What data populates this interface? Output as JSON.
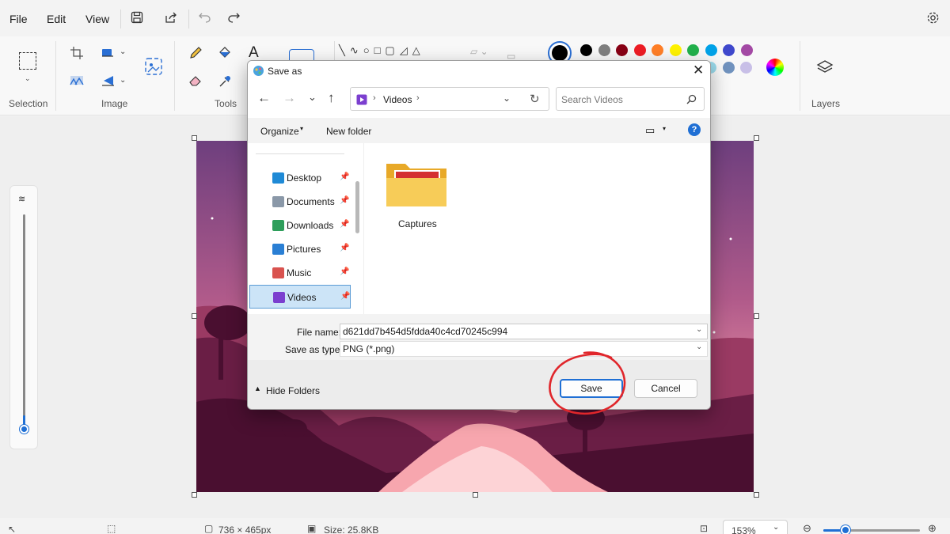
{
  "menu": {
    "file": "File",
    "edit": "Edit",
    "view": "View"
  },
  "ribbon": {
    "groups": {
      "selection": "Selection",
      "image": "Image",
      "tools": "Tools",
      "layers": "Layers"
    },
    "palette_row1": [
      "#000000",
      "#7f7f7f",
      "#880015",
      "#ed1c24",
      "#ff7f27",
      "#fff200",
      "#22b14c",
      "#00a2e8",
      "#3f48cc",
      "#a349a4"
    ],
    "palette_row2": [
      "#99d9ea",
      "#7092be",
      "#c8bfe7"
    ],
    "text_tool_glyph": "A"
  },
  "statusbar": {
    "dimensions": "736 × 465px",
    "size": "Size: 25.8KB",
    "zoom": "153%"
  },
  "dialog": {
    "title": "Save as",
    "breadcrumb": "Videos",
    "search_placeholder": "Search Videos",
    "organize": "Organize",
    "new_folder": "New folder",
    "nav_items": [
      {
        "label": "Desktop",
        "icon": "desktop-icon",
        "color": "#1f8ad6"
      },
      {
        "label": "Documents",
        "icon": "documents-icon",
        "color": "#8a98a8"
      },
      {
        "label": "Downloads",
        "icon": "downloads-icon",
        "color": "#2e9e5b"
      },
      {
        "label": "Pictures",
        "icon": "pictures-icon",
        "color": "#2a7fd4"
      },
      {
        "label": "Music",
        "icon": "music-icon",
        "color": "#d9534f"
      },
      {
        "label": "Videos",
        "icon": "videos-icon",
        "color": "#7b3fcf"
      }
    ],
    "folder_name": "Captures",
    "file_name_label": "File name:",
    "file_name_value": "d621dd7b454d5fdda40c4cd70245c994",
    "save_type_label": "Save as type:",
    "save_type_value": "PNG (*.png)",
    "hide_folders": "Hide Folders",
    "save": "Save",
    "cancel": "Cancel"
  }
}
